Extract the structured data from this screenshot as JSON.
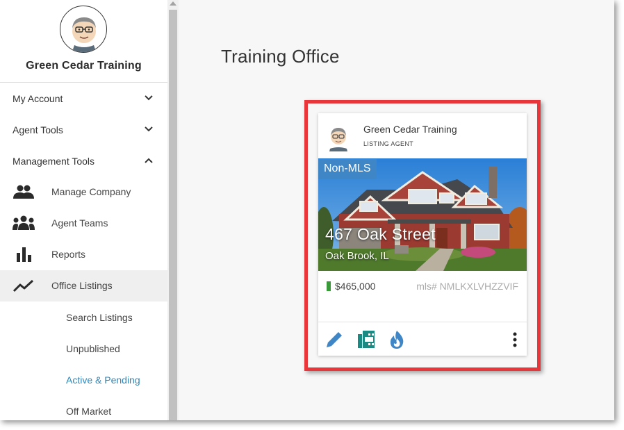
{
  "sidebar": {
    "profile_name": "Green Cedar Training",
    "sections": [
      {
        "label": "My Account",
        "expanded": false
      },
      {
        "label": "Agent Tools",
        "expanded": false
      },
      {
        "label": "Management Tools",
        "expanded": true
      }
    ],
    "items": [
      {
        "label": "Manage Company",
        "icon": "people-icon"
      },
      {
        "label": "Agent Teams",
        "icon": "team-icon"
      },
      {
        "label": "Reports",
        "icon": "bar-chart-icon"
      },
      {
        "label": "Office Listings",
        "icon": "trend-line-icon"
      }
    ],
    "subitems": [
      {
        "label": "Search Listings"
      },
      {
        "label": "Unpublished"
      },
      {
        "label": "Active & Pending"
      },
      {
        "label": "Off Market"
      }
    ]
  },
  "main": {
    "title": "Training Office"
  },
  "listing_card": {
    "agent_name": "Green Cedar Training",
    "agent_role": "LISTING AGENT",
    "badge": "Non-MLS",
    "street": "467 Oak Street",
    "city": "Oak Brook, IL",
    "price": "$465,000",
    "mls": "mls# NMLKXLVHZZVIF",
    "status_color": "#3a9a3a",
    "actions": [
      "edit-icon",
      "film-icon",
      "flame-icon",
      "more-vertical-icon"
    ]
  },
  "colors": {
    "accent_blue": "#3e86c5",
    "link_blue": "#2f86b9",
    "highlight_red": "#e8363a",
    "film_teal": "#1b8a83"
  }
}
